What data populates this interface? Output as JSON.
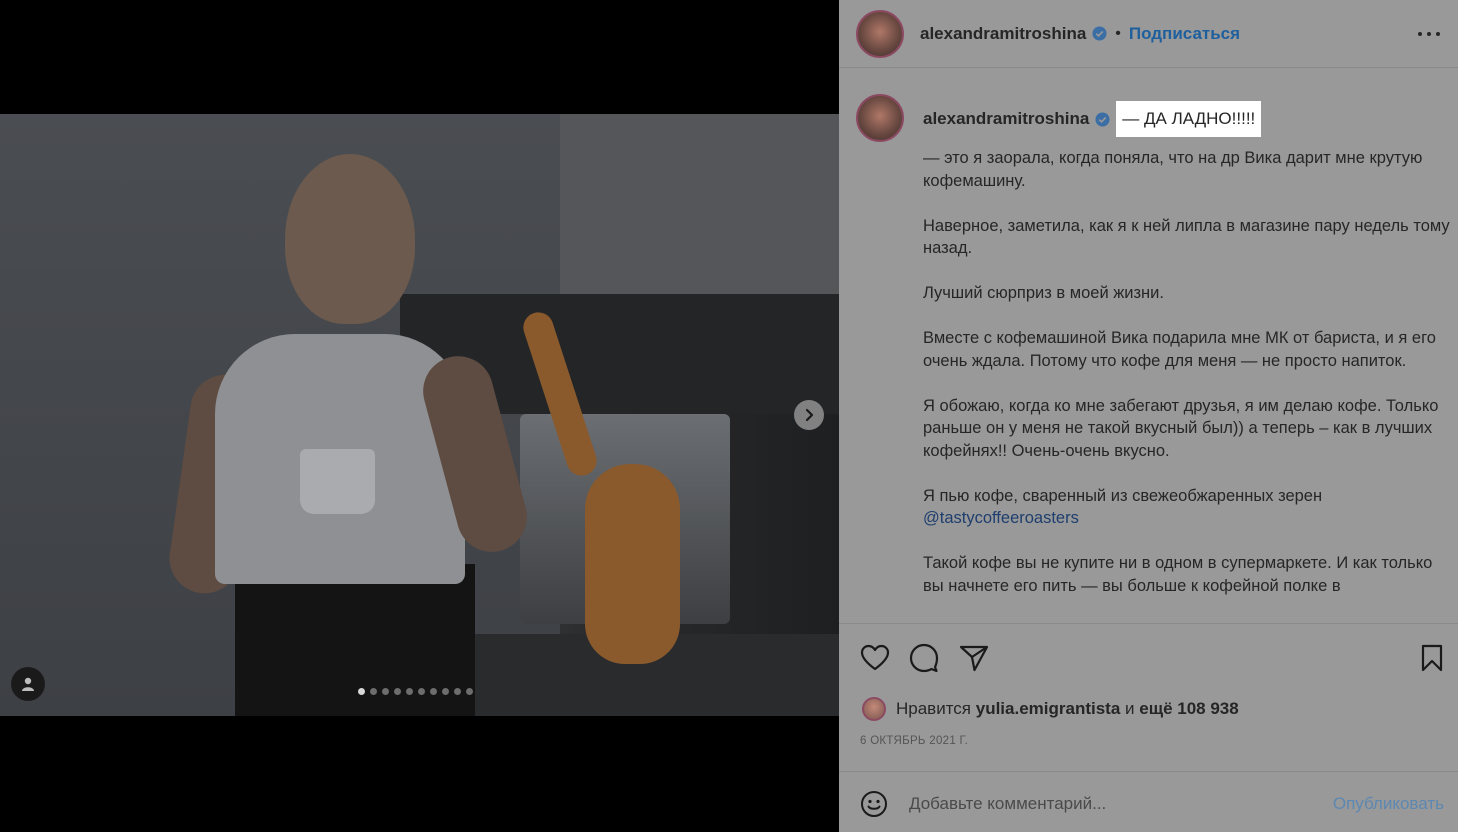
{
  "post": {
    "username": "alexandramitroshina",
    "follow_label": "Подписаться",
    "separator": "•"
  },
  "caption": {
    "username": "alexandramitroshina",
    "highlight": "— ДА ЛАДНО!!!!!",
    "paragraphs": [
      "— это я заорала, когда поняла, что на др Вика дарит мне крутую кофемашину.",
      "Наверное, заметила, как я к ней липла в магазине пару недель тому назад.",
      "Лучший сюрприз в моей жизни.",
      "Вместе с кофемашиной Вика подарила мне МК от бариста, и я его очень ждала. Потому что кофе для меня — не просто напиток.",
      "Я обожаю, когда ко мне забегают друзья, я им делаю кофе. Только раньше он у меня не такой вкусный был)) а теперь – как в лучших кофейнях!! Очень-очень вкусно."
    ],
    "paragraph_mention_prefix": "Я пью кофе, сваренный из свежеобжаренных зерен",
    "mention": "@tastycoffeeroasters",
    "last_paragraph": "Такой кофе вы не купите ни в одном в супермаркете. И как только вы начнете его пить — вы больше к кофейной полке в"
  },
  "likes": {
    "prefix": "Нравится",
    "user": "yulia.emigrantista",
    "middle": "и",
    "count": "ещё 108 938"
  },
  "date": "6 ОКТЯБРЬ 2021 Г.",
  "comment": {
    "placeholder": "Добавьте комментарий...",
    "publish_label": "Опубликовать"
  },
  "carousel": {
    "total_slides": 10,
    "active_index": 0
  },
  "colors": {
    "panel_bg": "#999999",
    "link": "#1e5f9e",
    "highlight_bg": "#ffffff"
  }
}
